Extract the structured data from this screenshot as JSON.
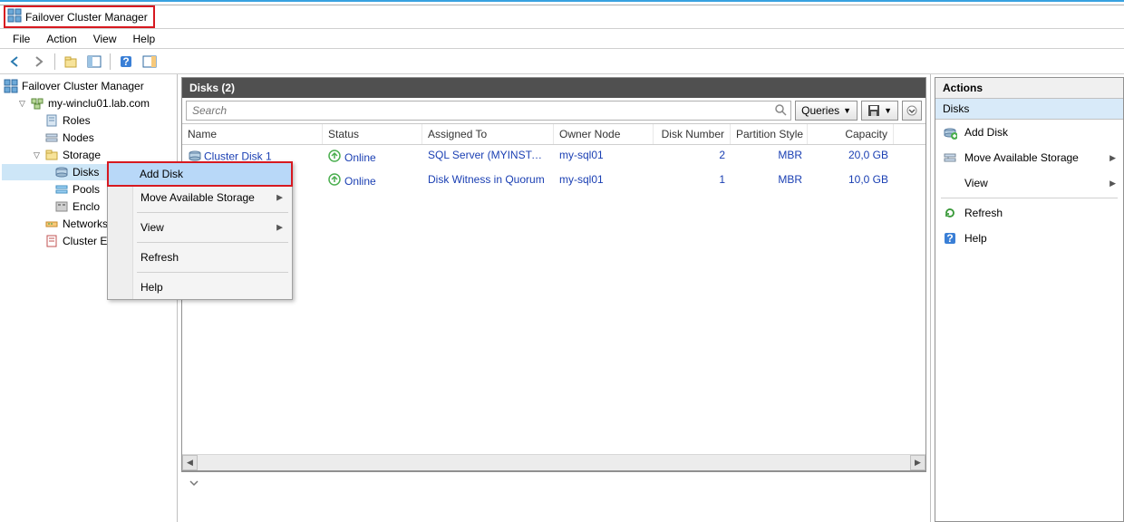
{
  "window": {
    "title": "Failover Cluster Manager"
  },
  "menu": {
    "file": "File",
    "action": "Action",
    "view": "View",
    "help": "Help"
  },
  "tree": {
    "root": "Failover Cluster Manager",
    "cluster": "my-winclu01.lab.com",
    "roles": "Roles",
    "nodes": "Nodes",
    "storage": "Storage",
    "disks": "Disks",
    "pools": "Pools",
    "enclosures": "Enclo",
    "networks": "Networks",
    "cluster_events": "Cluster E"
  },
  "center": {
    "header": "Disks (2)",
    "search_placeholder": "Search",
    "queries_label": "Queries",
    "columns": {
      "name": "Name",
      "status": "Status",
      "assigned": "Assigned To",
      "owner": "Owner Node",
      "disknum": "Disk Number",
      "partition": "Partition Style",
      "capacity": "Capacity"
    },
    "rows": [
      {
        "name": "Cluster Disk 1",
        "status": "Online",
        "assigned": "SQL Server (MYINSTANCE...",
        "owner": "my-sql01",
        "disknum": "2",
        "partition": "MBR",
        "capacity": "20,0 GB",
        "has_disk_icon": true
      },
      {
        "name": "",
        "status": "Online",
        "assigned": "Disk Witness in Quorum",
        "owner": "my-sql01",
        "disknum": "1",
        "partition": "MBR",
        "capacity": "10,0 GB",
        "has_disk_icon": false
      }
    ]
  },
  "context_menu": {
    "add_disk": "Add Disk",
    "move_storage": "Move Available Storage",
    "view": "View",
    "refresh": "Refresh",
    "help": "Help"
  },
  "actions": {
    "title": "Actions",
    "section": "Disks",
    "add_disk": "Add Disk",
    "move_storage": "Move Available Storage",
    "view": "View",
    "refresh": "Refresh",
    "help": "Help"
  }
}
